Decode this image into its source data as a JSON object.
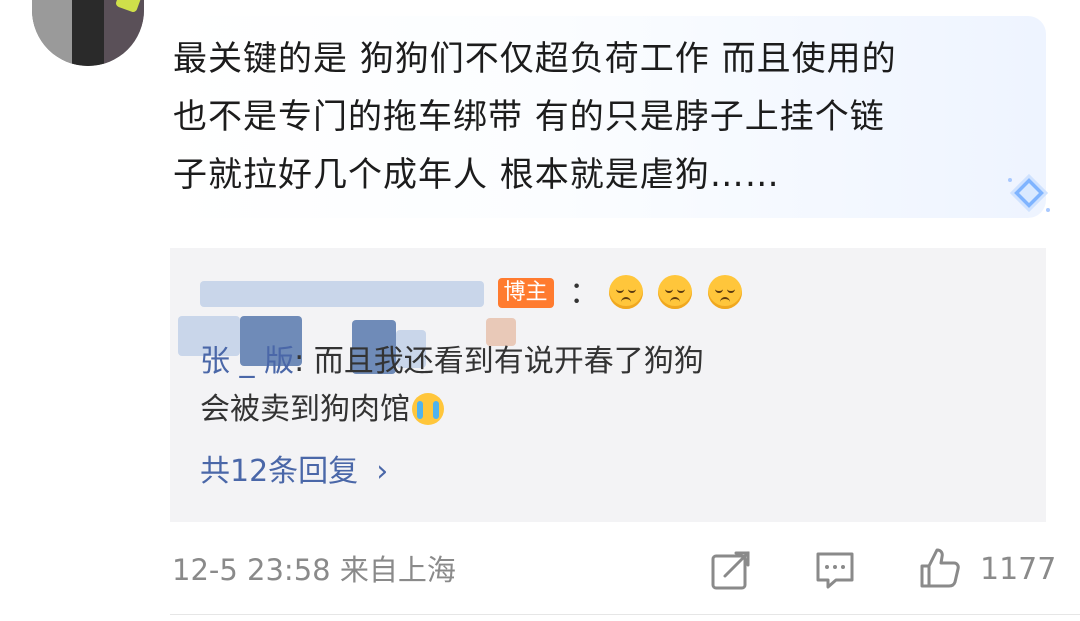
{
  "comment": {
    "text": "最关键的是 狗狗们不仅超负荷工作 而且使用的\n也不是专门的拖车绑带 有的只是脖子上挂个链\n子就拉好几个成年人 根本就是虐狗……"
  },
  "replies": {
    "reply1": {
      "badge": "博主",
      "separator": "："
    },
    "reply2": {
      "user_visible": "张     _       版",
      "line1": ": 而且我还看到有说开春了狗狗",
      "line2": "会被卖到狗肉馆"
    },
    "more_label": "共12条回复",
    "more_chevron": "›"
  },
  "footer": {
    "meta": "12-5 23:58 来自上海",
    "like_count": "1177"
  },
  "icons": [
    "diamond-icon",
    "smiley-sad-icon",
    "crying-face-icon",
    "share-icon",
    "comment-icon",
    "like-icon",
    "chevron-right-icon"
  ],
  "colors": {
    "link": "#4a67a8",
    "badge": "#ff7b2f",
    "reply_bg": "#f3f3f5",
    "meta": "#8a8a8a"
  }
}
